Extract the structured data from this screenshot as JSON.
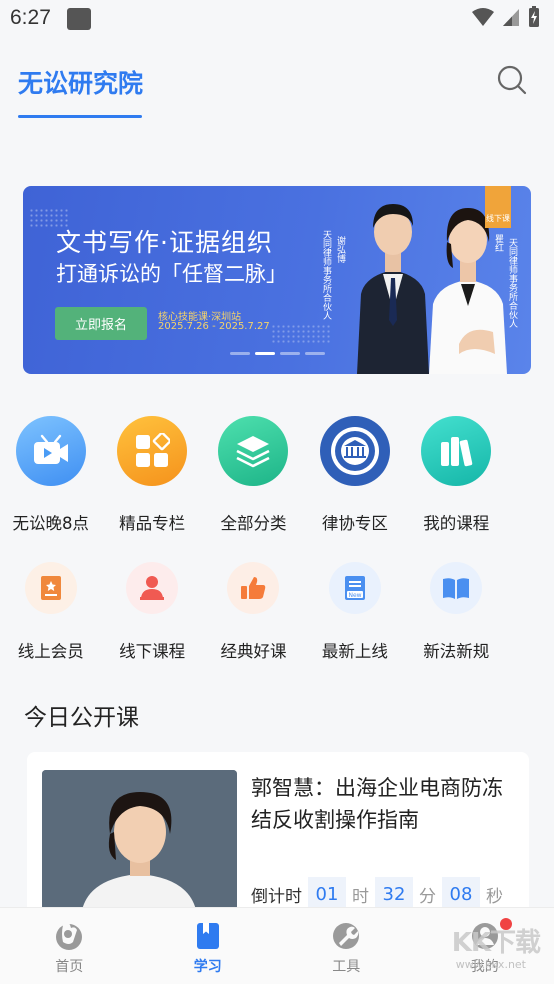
{
  "status_bar": {
    "time": "6:27"
  },
  "header": {
    "brand_tab": "无讼研究院"
  },
  "banner": {
    "title_line1": "文书写作·证据组织",
    "title_line2": "打通诉讼的「任督二脉」",
    "enroll_button": "立即报名",
    "subtitle_line1": "核心技能课·深圳站",
    "subtitle_line2": "2025.7.26 - 2025.7.27",
    "badge_text": "线下课",
    "speaker1_name": "谢弘博",
    "speaker1_title": "天同律师事务所合伙人",
    "speaker2_name": "瞿红",
    "speaker2_title": "天同律师事务所合伙人",
    "page_count": 4,
    "active_page": 2
  },
  "grid_primary": [
    {
      "label": "无讼晚8点",
      "icon": "video-camera-icon",
      "color": "#4a9cf5"
    },
    {
      "label": "精品专栏",
      "icon": "apps-grid-icon",
      "color": "#f5a623"
    },
    {
      "label": "全部分类",
      "icon": "layers-icon",
      "color": "#2ec49a"
    },
    {
      "label": "律协专区",
      "icon": "lawyers-association-icon",
      "color": "#2f5fb8"
    },
    {
      "label": "我的课程",
      "icon": "books-icon",
      "color": "#2cc4b4"
    }
  ],
  "grid_secondary": [
    {
      "label": "线上会员",
      "icon": "member-book-icon",
      "color": "#f0883c"
    },
    {
      "label": "线下课程",
      "icon": "teacher-icon",
      "color": "#f05a52"
    },
    {
      "label": "经典好课",
      "icon": "thumbs-up-icon",
      "color": "#f57b3a"
    },
    {
      "label": "最新上线",
      "icon": "new-document-icon",
      "color": "#4a8ff0"
    },
    {
      "label": "新法新规",
      "icon": "open-book-icon",
      "color": "#4a8ff0"
    }
  ],
  "section": {
    "title": "今日公开课"
  },
  "course": {
    "title": "郭智慧：出海企业电商防冻结反收割操作指南",
    "countdown_label": "倒计时",
    "hours": "01",
    "hours_unit": "时",
    "minutes": "32",
    "minutes_unit": "分",
    "seconds": "08",
    "seconds_unit": "秒"
  },
  "bottom_nav": [
    {
      "label": "首页",
      "icon": "home-icon",
      "active": false
    },
    {
      "label": "学习",
      "icon": "bookmark-book-icon",
      "active": true
    },
    {
      "label": "工具",
      "icon": "wrench-icon",
      "active": false
    },
    {
      "label": "我的",
      "icon": "profile-icon",
      "active": false
    }
  ],
  "watermark": {
    "text": "KK下载",
    "url": "www.kkx.net"
  }
}
